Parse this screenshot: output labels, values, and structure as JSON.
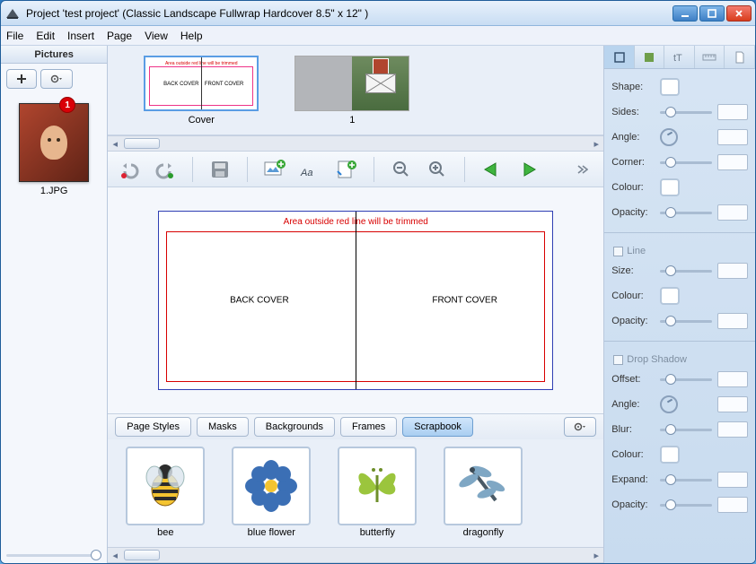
{
  "title": "Project 'test project' (Classic Landscape Fullwrap Hardcover 8.5\" x 12\" )",
  "menu": {
    "file": "File",
    "edit": "Edit",
    "insert": "Insert",
    "page": "Page",
    "view": "View",
    "help": "Help"
  },
  "pictures": {
    "header": "Pictures",
    "badge": "1",
    "items": [
      {
        "caption": "1.JPG"
      }
    ]
  },
  "spreads": {
    "cover_trim_text": "Area outside red line will be trimmed",
    "back_label": "BACK COVER",
    "front_label": "FRONT COVER",
    "items": [
      {
        "caption": "Cover"
      },
      {
        "caption": "1"
      }
    ]
  },
  "canvas": {
    "trim_note": "Area outside red line will be trimmed",
    "back": "BACK COVER",
    "front": "FRONT COVER"
  },
  "assets": {
    "tabs": {
      "page_styles": "Page Styles",
      "masks": "Masks",
      "backgrounds": "Backgrounds",
      "frames": "Frames",
      "scrapbook": "Scrapbook"
    },
    "active_tab": "scrapbook",
    "items": [
      {
        "name": "bee"
      },
      {
        "name": "blue flower"
      },
      {
        "name": "butterfly"
      },
      {
        "name": "dragonfly"
      }
    ]
  },
  "props": {
    "shape": "Shape:",
    "sides": "Sides:",
    "angle": "Angle:",
    "corner": "Corner:",
    "colour": "Colour:",
    "opacity": "Opacity:",
    "line_section": "Line",
    "size": "Size:",
    "shadow_section": "Drop Shadow",
    "offset": "Offset:",
    "blur": "Blur:",
    "expand": "Expand:"
  }
}
